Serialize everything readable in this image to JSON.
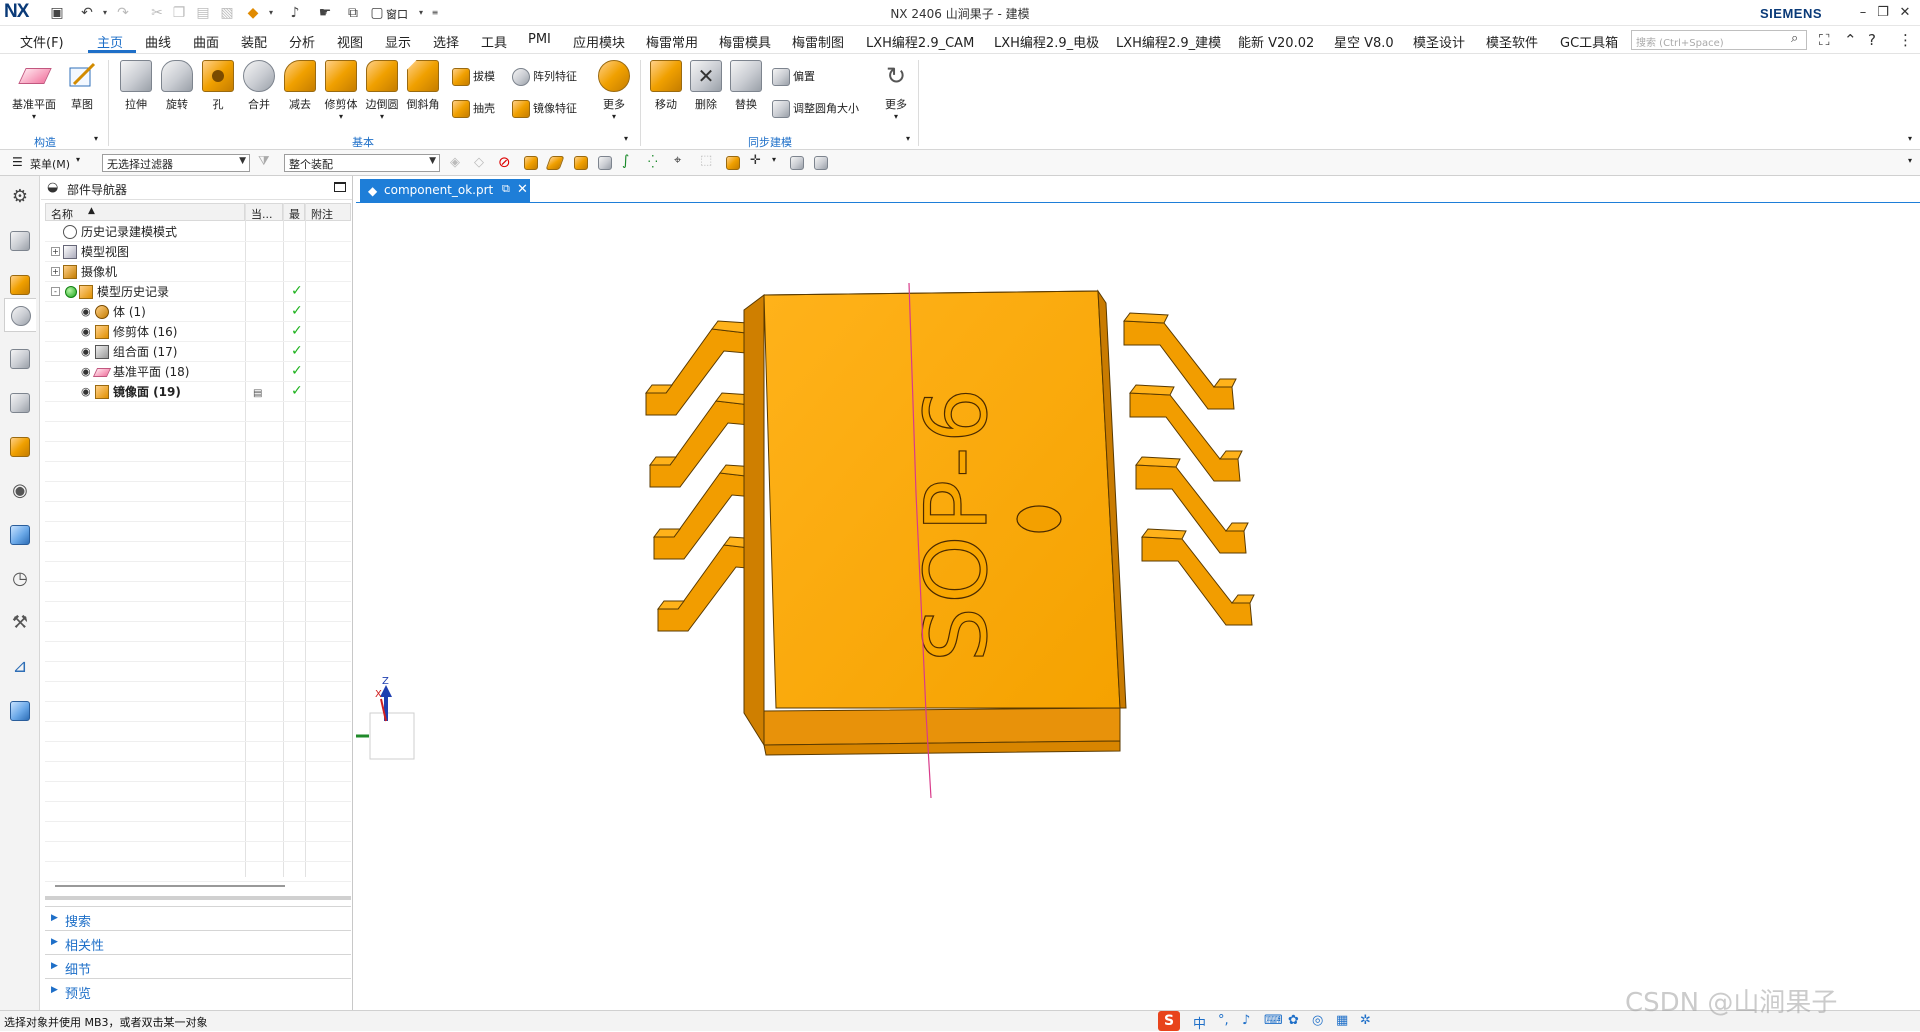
{
  "app": {
    "logo": "NX",
    "window_title": "NX 2406 山涧果子 - 建模",
    "brand": "SIEMENS",
    "window_menu_label": "窗口"
  },
  "menubar": {
    "items": [
      "文件(F)",
      "主页",
      "曲线",
      "曲面",
      "装配",
      "分析",
      "视图",
      "显示",
      "选择",
      "工具",
      "PMI",
      "应用模块",
      "梅雷常用",
      "梅雷模具",
      "梅雷制图",
      "LXH编程2.9_CAM",
      "LXH编程2.9_电极",
      "LXH编程2.9_建模",
      "能新 V20.02",
      "星空 V8.0",
      "模圣设计",
      "模圣软件",
      "GC工具箱"
    ],
    "active": "主页",
    "search_placeholder": "搜索 (Ctrl+Space)"
  },
  "ribbon": {
    "groups": [
      {
        "label": "构造",
        "buttons": [
          "基准平面",
          "草图"
        ]
      },
      {
        "label": "基本",
        "buttons": [
          "拉伸",
          "旋转",
          "孔",
          "合并",
          "减去",
          "修剪体",
          "边倒圆",
          "倒斜角",
          "拔模",
          "抽壳",
          "阵列特征",
          "镜像特征",
          "更多"
        ]
      },
      {
        "label": "同步建模",
        "buttons": [
          "移动",
          "删除",
          "替换",
          "偏置",
          "调整圆角大小",
          "更多"
        ]
      }
    ]
  },
  "selection_bar": {
    "menu_label": "菜单(M)",
    "filter_value": "无选择过滤器",
    "scope_value": "整个装配"
  },
  "navigator": {
    "title": "部件导航器",
    "columns": [
      "名称",
      "当...",
      "最",
      "附注"
    ],
    "tree": [
      {
        "label": "历史记录建模模式",
        "indent": 0,
        "expander": "",
        "visible": false,
        "check": false,
        "bold": false,
        "icon": "clock-icon"
      },
      {
        "label": "模型视图",
        "indent": 0,
        "expander": "+",
        "visible": false,
        "check": false,
        "bold": false,
        "icon": "model-views-icon"
      },
      {
        "label": "摄像机",
        "indent": 0,
        "expander": "+",
        "visible": false,
        "check": false,
        "bold": false,
        "icon": "camera-icon"
      },
      {
        "label": "模型历史记录",
        "indent": 0,
        "expander": "-",
        "visible": false,
        "check": true,
        "bold": false,
        "icon": "history-icon"
      },
      {
        "label": "体 (1)",
        "indent": 1,
        "expander": "",
        "visible": true,
        "check": true,
        "bold": false,
        "icon": "body-icon"
      },
      {
        "label": "修剪体 (16)",
        "indent": 1,
        "expander": "",
        "visible": true,
        "check": true,
        "bold": false,
        "icon": "trim-body-icon"
      },
      {
        "label": "组合面 (17)",
        "indent": 1,
        "expander": "",
        "visible": true,
        "check": true,
        "bold": false,
        "icon": "combine-faces-icon"
      },
      {
        "label": "基准平面 (18)",
        "indent": 1,
        "expander": "",
        "visible": true,
        "check": true,
        "bold": false,
        "icon": "datum-plane-icon"
      },
      {
        "label": "镜像面 (19)",
        "indent": 1,
        "expander": "",
        "visible": true,
        "check": true,
        "bold": true,
        "icon": "mirror-face-icon"
      }
    ],
    "sections": [
      "搜索",
      "相关性",
      "细节",
      "预览"
    ]
  },
  "document": {
    "tab_label": "component_ok.prt"
  },
  "viewport": {
    "part_text": "SOP-6",
    "triad_labels": {
      "z": "Z",
      "y": "Y",
      "x": "X"
    },
    "part_color": "#F5A300"
  },
  "status": {
    "message": "选择对象并使用 MB3，或者双击某一对象",
    "ime_label": "中"
  },
  "watermark": "CSDN @山涧果子"
}
